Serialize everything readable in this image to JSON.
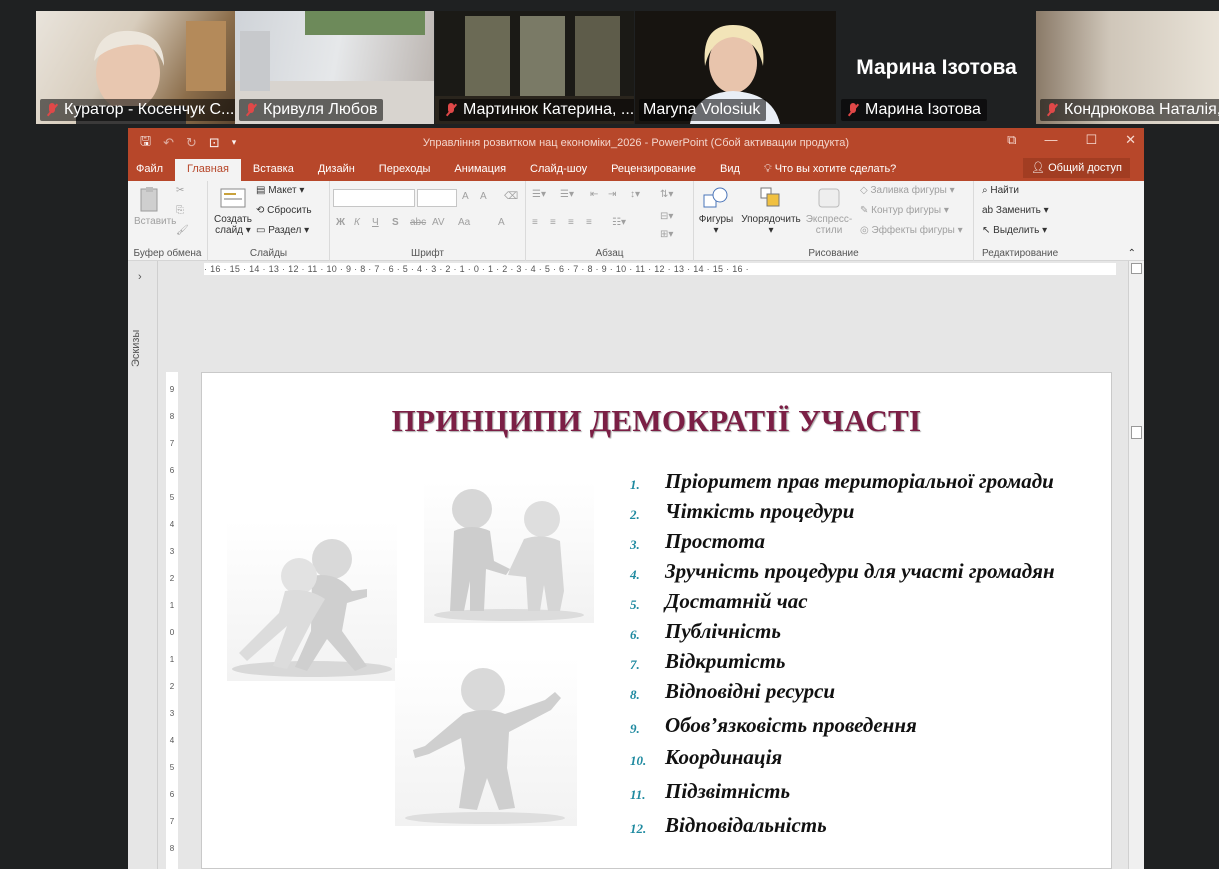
{
  "participants": [
    {
      "name": "Куратор - Косенчук С...",
      "muted": true
    },
    {
      "name": "Кривуля Любов",
      "muted": true
    },
    {
      "name": "Мартинюк Катерина, ...",
      "muted": true
    },
    {
      "name": "Maryna Volosiuk",
      "muted": false,
      "active": true
    },
    {
      "name": "Марина Ізотова",
      "muted": true,
      "big_name": "Марина Ізотова"
    },
    {
      "name": "Кондрюкова Наталія,",
      "muted": true
    }
  ],
  "window": {
    "title": "Управління розвитком нац економіки_2026 - PowerPoint (Сбой активации продукта)",
    "accent": "#b7472a"
  },
  "tabs": [
    "Файл",
    "Главная",
    "Вставка",
    "Дизайн",
    "Переходы",
    "Анимация",
    "Слайд-шоу",
    "Рецензирование",
    "Вид",
    "Что вы хотите сделать?"
  ],
  "share_label": "Общий доступ",
  "ribbon": {
    "groups": {
      "clipboard": "Буфер обмена",
      "slides": "Слайды",
      "font": "Шрифт",
      "paragraph": "Абзац",
      "drawing": "Рисование",
      "editing": "Редактирование"
    },
    "paste": "Вставить",
    "new_slide": "Создать",
    "new_slide2": "слайд",
    "layout": "Макет",
    "reset": "Сбросить",
    "section": "Раздел",
    "shapes": "Фигуры",
    "arrange": "Упорядочить",
    "express1": "Экспресс-",
    "express2": "стили",
    "fill": "Заливка фигуры",
    "outline": "Контур фигуры",
    "effects": "Эффекты фигуры",
    "find": "Найти",
    "replace": "Заменить",
    "select": "Выделить",
    "bold": "Ж",
    "italic": "К",
    "underline": "Ч",
    "strike": "S",
    "abc": "abc",
    "av": "AV",
    "aa": "Aa",
    "fontcolor": "A"
  },
  "ruler_h": "· 16 · 15 · 14 · 13 · 12 · 11 · 10 · 9 · 8 · 7 · 6 · 5 · 4 · 3 · 2 · 1 · 0 · 1 · 2 · 3 · 4 · 5 · 6 · 7 · 8 · 9 · 10 · 11 · 12 · 13 · 14 · 15 · 16 ·",
  "ruler_v": [
    "9",
    "8",
    "7",
    "6",
    "5",
    "4",
    "3",
    "2",
    "1",
    "0",
    "1",
    "2",
    "3",
    "4",
    "5",
    "6",
    "7",
    "8"
  ],
  "thumbnails_label": "Эскизы",
  "slide": {
    "title": "ПРИНЦИПИ ДЕМОКРАТІЇ УЧАСТІ",
    "title_color": "#7b1f45",
    "number_color": "#1f8aa0",
    "principles": [
      {
        "n": "1.",
        "text": "Пріоритет прав територіальної громади"
      },
      {
        "n": "2.",
        "text": "Чіткість процедури"
      },
      {
        "n": "3.",
        "text": "Простота"
      },
      {
        "n": "4.",
        "text": "Зручність процедури для участі громадян"
      },
      {
        "n": "5.",
        "text": "Достатній час"
      },
      {
        "n": "6.",
        "text": "Публічність"
      },
      {
        "n": "7.",
        "text": "Відкритість"
      },
      {
        "n": "8.",
        "text": "Відповідні ресурси"
      },
      {
        "n": "9.",
        "text": "Обов’язковість проведення"
      },
      {
        "n": "10.",
        "text": "Координація"
      },
      {
        "n": "11.",
        "text": "Підзвітність"
      },
      {
        "n": "12.",
        "text": "Відповідальність"
      }
    ]
  }
}
